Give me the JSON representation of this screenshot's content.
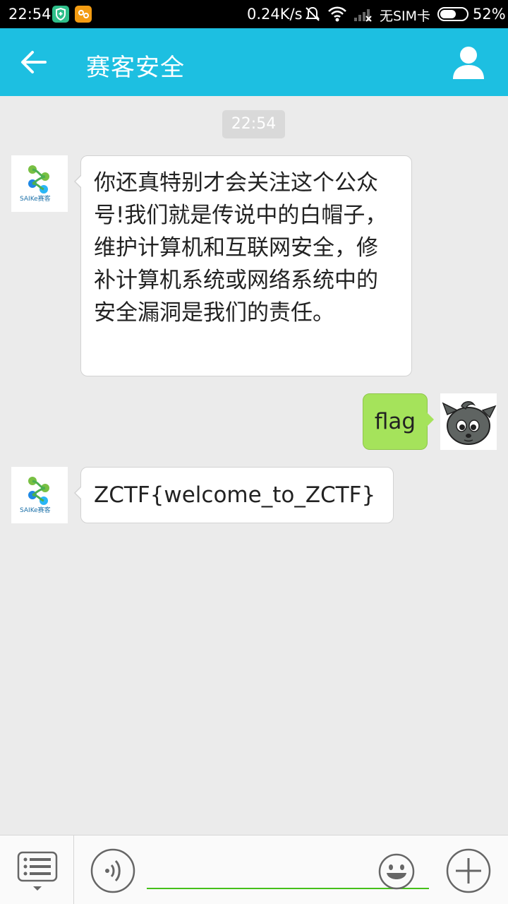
{
  "status_bar": {
    "time": "22:54",
    "network_speed": "0.24K/s",
    "sim_status": "无SIM卡",
    "battery_percent": "52%",
    "icons": [
      "shield-app-icon",
      "game-app-icon",
      "mute-icon",
      "wifi-icon",
      "signal-icon",
      "battery-icon"
    ]
  },
  "header": {
    "title": "赛客安全",
    "back_icon": "arrow-left-icon",
    "profile_icon": "person-icon",
    "background_color": "#1dbfe1"
  },
  "chat": {
    "timestamp": "22:54",
    "messages": [
      {
        "sender": "account",
        "avatar_text": "SAIKe赛客",
        "text": "你还真特别才会关注这个公众号!我们就是传说中的白帽子，维护计算机和互联网安全，修补计算机系统或网络系统中的安全漏洞是我们的责任。"
      },
      {
        "sender": "me",
        "text": "flag"
      },
      {
        "sender": "account",
        "avatar_text": "SAIKe赛客",
        "text": "ZCTF{welcome_to_ZCTF}"
      }
    ]
  },
  "input_bar": {
    "placeholder": "",
    "accent_color": "#45c01a",
    "icons": [
      "menu-list-icon",
      "voice-icon",
      "emoji-icon",
      "plus-icon"
    ]
  }
}
